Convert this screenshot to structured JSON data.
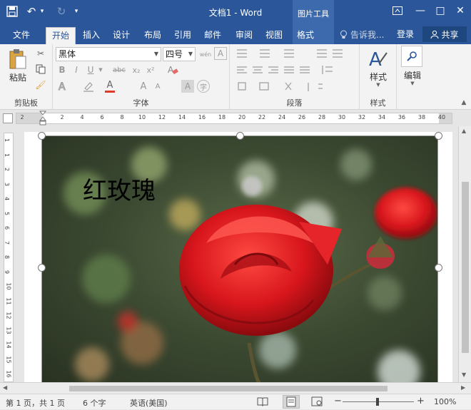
{
  "window": {
    "title": "文档1 - Word",
    "context_group": "图片工具"
  },
  "quick_access": {
    "save": "💾",
    "undo": "↶",
    "undo_arrow": "▾",
    "redo": "↻",
    "customize": "▾"
  },
  "window_controls": {
    "ribbon_display": "⤒",
    "minimize": "—",
    "maximize": "□",
    "close": "✕"
  },
  "tabs": [
    "文件",
    "开始",
    "插入",
    "设计",
    "布局",
    "引用",
    "邮件",
    "审阅",
    "视图",
    "格式"
  ],
  "tell_me": "告诉我...",
  "login": "登录",
  "share": "共享",
  "clipboard": {
    "paste": "粘贴",
    "label": "剪贴板"
  },
  "font": {
    "name": "黑体",
    "size": "四号",
    "label": "字体",
    "bold": "B",
    "italic": "I",
    "underline": "U",
    "strike": "abc",
    "subscript": "x₂",
    "superscript": "x²",
    "font_color": "A",
    "grow": "A",
    "shrink": "A",
    "phonetic": "wén",
    "char_border": "A",
    "char_shade": "A",
    "enclose": "字"
  },
  "paragraph": {
    "label": "段落"
  },
  "styles": {
    "button": "样式",
    "label": "样式"
  },
  "editing": {
    "button": "编辑"
  },
  "ruler": {
    "h": [
      "2",
      "2",
      "4",
      "6",
      "8",
      "10",
      "12",
      "14",
      "16",
      "18",
      "20",
      "22",
      "24",
      "26",
      "28",
      "30",
      "32",
      "34",
      "36",
      "38",
      "40"
    ],
    "v": [
      "1",
      "1",
      "2",
      "3",
      "4",
      "5",
      "6",
      "7",
      "8",
      "9",
      "10",
      "11",
      "12",
      "13",
      "14",
      "15",
      "16"
    ]
  },
  "document": {
    "caption": "红玫瑰"
  },
  "status": {
    "page": "第 1 页，共 1 页",
    "words": "6 个字",
    "language": "英语(美国)",
    "zoom": "100%",
    "minus": "−",
    "plus": "+"
  },
  "colors": {
    "brand": "#2b579a",
    "rose": "#c8141b",
    "font_color_underline": "#e03b2a"
  }
}
